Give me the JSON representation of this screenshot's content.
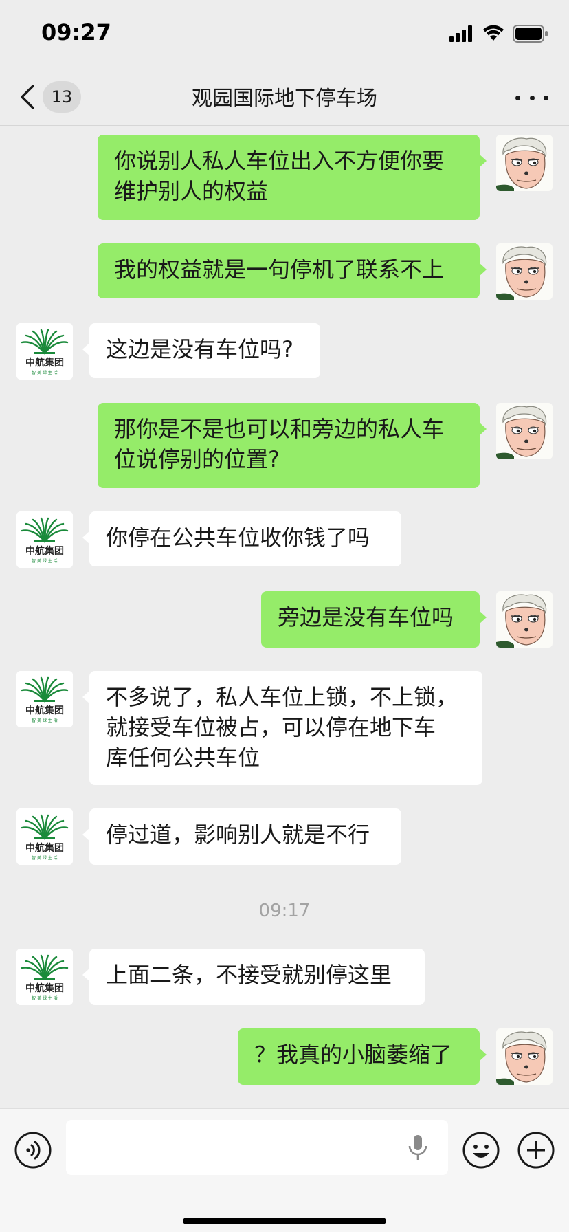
{
  "status": {
    "time": "09:27"
  },
  "nav": {
    "unread_count": "13",
    "title": "观园国际地下停车场"
  },
  "messages": [
    {
      "side": "sent",
      "lines": [
        "你说别人私人车位出入不方便你要",
        "维护别人的权益"
      ]
    },
    {
      "side": "sent",
      "lines": [
        "我的权益就是一句停机了联系不上"
      ]
    },
    {
      "side": "recv",
      "lines": [
        "这边是没有车位吗?"
      ]
    },
    {
      "side": "sent",
      "lines": [
        "那你是不是也可以和旁边的私人车",
        "位说停别的位置?"
      ]
    },
    {
      "side": "recv",
      "lines": [
        "你停在公共车位收你钱了吗"
      ]
    },
    {
      "side": "sent",
      "lines": [
        "旁边是没有车位吗"
      ]
    },
    {
      "side": "recv",
      "lines": [
        "不多说了，私人车位上锁，不上锁，",
        "就接受车位被占，可以停在地下车",
        "库任何公共车位"
      ]
    },
    {
      "side": "recv",
      "lines": [
        "停过道，影响别人就是不行"
      ]
    },
    {
      "type": "time",
      "text": "09:17"
    },
    {
      "side": "recv",
      "lines": [
        "上面二条，不接受就别停这里"
      ]
    },
    {
      "side": "sent",
      "lines": [
        "？我真的小脑萎缩了"
      ]
    }
  ],
  "recv_avatar": {
    "brand_text": "中航集团",
    "slogan": "智 美 绿 生 活",
    "color": "#1a8a3a"
  },
  "colors": {
    "sent_bubble": "#95ec69",
    "recv_bubble": "#ffffff",
    "background": "#ededed"
  },
  "input": {
    "placeholder": "",
    "value": ""
  }
}
